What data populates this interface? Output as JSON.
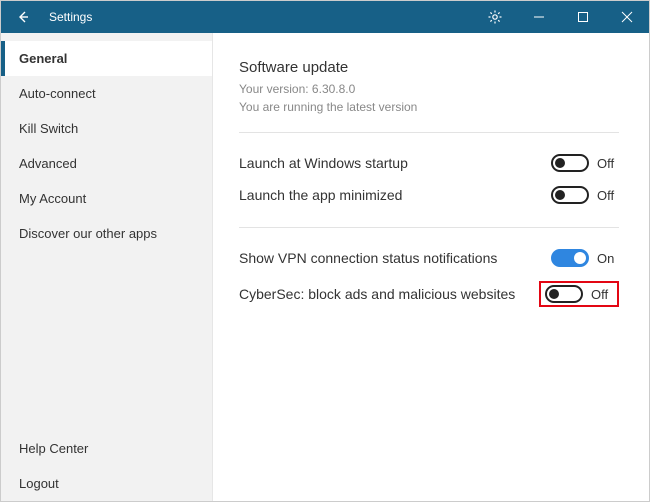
{
  "titlebar": {
    "title": "Settings"
  },
  "sidebar": {
    "items": [
      {
        "label": "General",
        "active": true
      },
      {
        "label": "Auto-connect"
      },
      {
        "label": "Kill Switch"
      },
      {
        "label": "Advanced"
      },
      {
        "label": "My Account"
      },
      {
        "label": "Discover our other apps"
      }
    ],
    "bottom": [
      {
        "label": "Help Center"
      },
      {
        "label": "Logout"
      }
    ]
  },
  "content": {
    "update": {
      "heading": "Software update",
      "version_line": "Your version: 6.30.8.0",
      "status_line": "You are running the latest version"
    },
    "toggles": {
      "launch_startup": {
        "label": "Launch at Windows startup",
        "state": "Off"
      },
      "launch_minimized": {
        "label": "Launch the app minimized",
        "state": "Off"
      },
      "notifications": {
        "label": "Show VPN connection status notifications",
        "state": "On"
      },
      "cybersec": {
        "label": "CyberSec: block ads and malicious websites",
        "state": "Off"
      }
    }
  }
}
